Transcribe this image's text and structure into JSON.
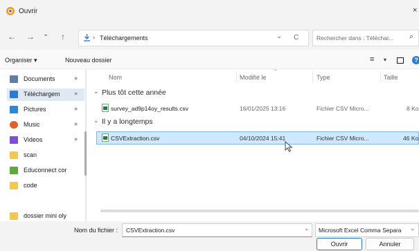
{
  "window": {
    "title": "Ouvrir",
    "close_glyph": "×"
  },
  "nav": {
    "back_glyph": "←",
    "forward_glyph": "→",
    "recent_glyph": "⌄",
    "up_glyph": "↑",
    "path_sep": "›",
    "folder": "Téléchargements",
    "dropdown_glyph": "⌄",
    "refresh_glyph": "C",
    "search_placeholder": "Rechercher dans : Téléchar...",
    "search_glyph": "⌕"
  },
  "toolbar": {
    "organize": "Organiser",
    "organize_glyph": "▾",
    "new_folder": "Nouveau dossier",
    "view_glyph": "≡",
    "view_dropdown_glyph": "▾",
    "pane_glyph": "□",
    "help_glyph": "?"
  },
  "sidebar": {
    "items": [
      {
        "label": "Documents",
        "pin": "★",
        "icon_color": "#5f7ea6"
      },
      {
        "label": "Téléchargem",
        "pin": "★",
        "icon_color": "#2a7bd6"
      },
      {
        "label": "Pictures",
        "pin": "★",
        "icon_color": "#2b88d8"
      },
      {
        "label": "Music",
        "pin": "★",
        "icon_color": "#e0622f"
      },
      {
        "label": "Videos",
        "pin": "★",
        "icon_color": "#7b4fd6"
      },
      {
        "label": "scan",
        "pin": "",
        "icon_color": "#f2c94c"
      },
      {
        "label": "Educonnect cor",
        "pin": "",
        "icon_color": "#5fa83a"
      },
      {
        "label": "code",
        "pin": "",
        "icon_color": "#f2c94c"
      },
      {
        "label": "dossier mini oly",
        "pin": "",
        "icon_color": "#f2c94c"
      }
    ]
  },
  "columns": {
    "name": "Nom",
    "modified": "Modifié le",
    "type": "Type",
    "size": "Taille",
    "sort_glyph": "⌄"
  },
  "groups": [
    {
      "label": "Plus tôt cette année",
      "chevron": "⌄",
      "files": [
        {
          "name": "survey_ad9p14oy_results.csv",
          "modified": "16/01/2025 13:16",
          "type": "Fichier CSV Micro...",
          "size": "8 Ko"
        }
      ]
    },
    {
      "label": "Il y a longtemps",
      "chevron": "⌄",
      "files": [
        {
          "name": "CSVExtraction.csv",
          "modified": "04/10/2024 15:41",
          "type": "Fichier CSV Micro...",
          "size": "46 Ko"
        }
      ]
    }
  ],
  "footer": {
    "filename_label": "Nom du fichier :",
    "filename_value": "CSVExtraction.csv",
    "filename_dropdown_glyph": "⌄",
    "filetype_value": "Microsoft Excel Comma Separa",
    "filetype_dropdown_glyph": "⌄",
    "open_label": "Ouvrir",
    "cancel_label": "Annuler"
  }
}
